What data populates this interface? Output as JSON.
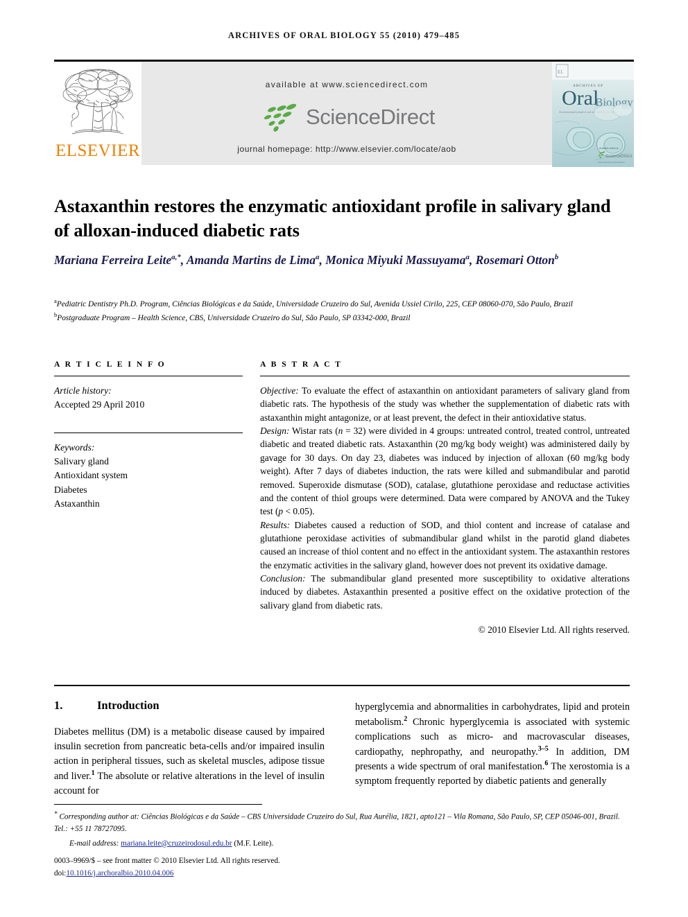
{
  "running_head": "ARCHIVES OF ORAL BIOLOGY 55 (2010) 479–485",
  "masthead": {
    "available_at": "available at www.sciencedirect.com",
    "sciencedirect_logo_text": "ScienceDirect",
    "journal_homepage": "journal homepage: http://www.elsevier.com/locate/aob",
    "elsevier_wordmark": "ELSEVIER",
    "cover_title_line1": "ARCHIVES OF",
    "cover_title_line2": "Oral",
    "cover_title_line3": "Biology",
    "cover_tagline": "An international journal of oral and craniofacial sciences",
    "cover_badge": "ScienceDirect",
    "colors": {
      "band_background": "#e8e8e8",
      "sciencedirect_green": "#5aab46",
      "sciencedirect_gray": "#77787b",
      "elsevier_orange": "#f08000",
      "cover_teal": "#5f9ea8"
    }
  },
  "article": {
    "title": "Astaxanthin restores the enzymatic antioxidant profile in salivary gland of alloxan-induced diabetic rats",
    "authors_html": "Mariana Ferreira Leite<sup>a,</sup><sup>*</sup>, Amanda Martins de Lima<sup>a</sup>, Monica Miyuki Massuyama<sup>a</sup>, Rosemari Otton<sup>b</sup>",
    "affiliation_a": "Pediatric Dentistry Ph.D. Program, Ciências Biológicas e da Saúde, Universidade Cruzeiro do Sul, Avenida Ussiel Cirilo, 225, CEP 08060-070, São Paulo, Brazil",
    "affiliation_b": "Postgraduate Program – Health Science, CBS, Universidade Cruzeiro do Sul, São Paulo, SP 03342-000, Brazil",
    "affiliation_a_marker": "a",
    "affiliation_b_marker": "b"
  },
  "article_info": {
    "heading": "A R T I C L E   I N F O",
    "history_label": "Article history:",
    "history_value": "Accepted 29 April 2010",
    "keywords_label": "Keywords:",
    "keywords": [
      "Salivary gland",
      "Antioxidant system",
      "Diabetes",
      "Astaxanthin"
    ]
  },
  "abstract": {
    "heading": "A B S T R A C T",
    "objective_label": "Objective:",
    "objective_text": " To evaluate the effect of astaxanthin on antioxidant parameters of salivary gland from diabetic rats. The hypothesis of the study was whether the supplementation of diabetic rats with astaxanthin might antagonize, or at least prevent, the defect in their antioxidative status.",
    "design_label": "Design:",
    "design_text_html": " Wistar rats (<i>n</i> = 32) were divided in 4 groups: untreated control, treated control, untreated diabetic and treated diabetic rats. Astaxanthin (20 mg/kg body weight) was administered daily by gavage for 30 days. On day 23, diabetes was induced by injection of alloxan (60 mg/kg body weight). After 7 days of diabetes induction, the rats were killed and submandibular and parotid removed. Superoxide dismutase (SOD), catalase, glutathione peroxidase and reductase activities and the content of thiol groups were determined. Data were compared by ANOVA and the Tukey test (<i>p</i> &lt; 0.05).",
    "results_label": "Results:",
    "results_text": " Diabetes caused a reduction of SOD, and thiol content and increase of catalase and glutathione peroxidase activities of submandibular gland whilst in the parotid gland diabetes caused an increase of thiol content and no effect in the antioxidant system. The astaxanthin restores the enzymatic activities in the salivary gland, however does not prevent its oxidative damage.",
    "conclusion_label": "Conclusion:",
    "conclusion_text": " The submandibular gland presented more susceptibility to oxidative alterations induced by diabetes. Astaxanthin presented a positive effect on the oxidative protection of the salivary gland from diabetic rats.",
    "copyright": "© 2010 Elsevier Ltd. All rights reserved."
  },
  "introduction": {
    "number": "1.",
    "heading": "Introduction",
    "left_column_html": "Diabetes mellitus (DM) is a metabolic disease caused by impaired insulin secretion from pancreatic beta-cells and/or impaired insulin action in peripheral tissues, such as skeletal muscles, adipose tissue and liver.<sup>1</sup> The absolute or relative alterations in the level of insulin account for",
    "right_column_html": "hyperglycemia and abnormalities in carbohydrates, lipid and protein metabolism.<sup>2</sup> Chronic hyperglycemia is associated with systemic complications such as micro- and macrovascular diseases, cardiopathy, nephropathy, and neuropathy.<sup>3–5</sup> In addition, DM presents a wide spectrum of oral manifestation.<sup>6</sup> The xerostomia is a symptom frequently reported by diabetic patients and generally"
  },
  "footer": {
    "corresponding_marker": "*",
    "corresponding_label": "Corresponding author at:",
    "corresponding_text": " Ciências Biológicas e da Saúde – CBS Universidade Cruzeiro do Sul, Rua Aurélia, 1821, apto121 – Vila Romana, São Paulo, SP, CEP 05046-001, Brazil. Tel.: +55 11 78727095.",
    "email_label": "E-mail address:",
    "email_address": "mariana.leite@cruzeirodosul.edu.br",
    "email_attribution": " (M.F. Leite).",
    "front_matter": "0003–9969/$ – see front matter © 2010 Elsevier Ltd. All rights reserved.",
    "doi_label": "doi:",
    "doi_value": "10.1016/j.archoralbio.2010.04.006"
  }
}
